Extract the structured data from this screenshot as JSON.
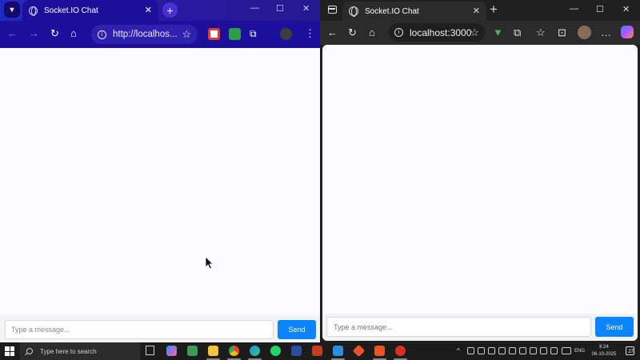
{
  "left_window": {
    "browser": "Chrome",
    "tab": {
      "title": "Socket.IO Chat"
    },
    "address_bar": {
      "url": "http://localhos..."
    },
    "chat": {
      "input_placeholder": "Type a message...",
      "send_label": "Send",
      "messages": []
    }
  },
  "right_window": {
    "browser": "Edge",
    "tab": {
      "title": "Socket.IO Chat"
    },
    "address_bar": {
      "url": "localhost:3000"
    },
    "chat": {
      "input_placeholder": "Type a message...",
      "send_label": "Send",
      "messages": []
    }
  },
  "taskbar": {
    "search_placeholder": "Type here to search",
    "language": "ENG",
    "time": "8:24",
    "date": "06-10-2025",
    "notification_count": "27",
    "pinned_apps": [
      "copilot-icon",
      "teams-icon",
      "file-explorer-icon",
      "chrome-icon",
      "edge-icon",
      "whatsapp-icon",
      "terminal-icon",
      "powerpoint-icon",
      "vscode-icon",
      "git-icon",
      "ubuntu-icon",
      "chrome-red-icon"
    ]
  },
  "colors": {
    "chrome_toolbar": "#1c0f9c",
    "edge_toolbar": "#2b2b2b",
    "send_button": "#0a84ff",
    "chat_background": "#fbfbfe"
  }
}
